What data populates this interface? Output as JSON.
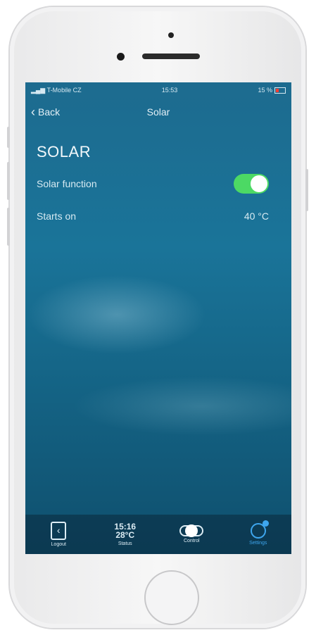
{
  "status": {
    "carrier": "T-Mobile CZ",
    "time": "15:53",
    "battery": "15 %"
  },
  "nav": {
    "back_label": "Back",
    "title": "Solar"
  },
  "section": {
    "title": "SOLAR"
  },
  "settings": [
    {
      "label": "Solar function",
      "type": "toggle",
      "enabled": true
    },
    {
      "label": "Starts on",
      "value": "40 °C"
    }
  ],
  "tabbar": {
    "logout": "Logout",
    "time_top": "15:16",
    "time_bottom": "28°C",
    "status": "Status",
    "control": "Control",
    "settings": "Settings"
  },
  "colors": {
    "toggle_on": "#4cd964",
    "active_tab": "#3ea6ee"
  }
}
